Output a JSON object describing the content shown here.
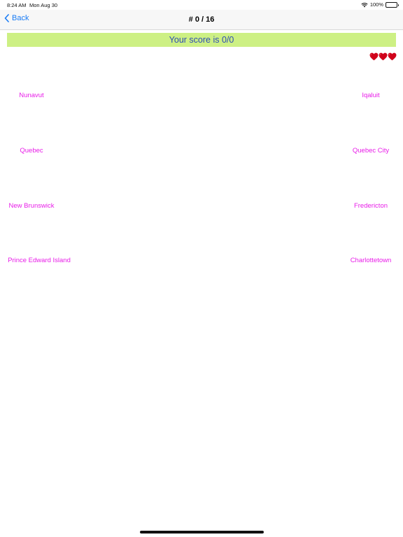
{
  "status_bar": {
    "time": "8:24 AM",
    "date": "Mon Aug 30",
    "battery": "100%"
  },
  "nav": {
    "back_label": "Back",
    "title": "# 0 / 16"
  },
  "score": {
    "text": "Your score is 0/0"
  },
  "lives": {
    "count": 3,
    "icon": "heart-icon",
    "color": "#d0021b"
  },
  "provinces": [
    {
      "label": "Nunavut"
    },
    {
      "label": "Quebec"
    },
    {
      "label": "New Brunswick"
    },
    {
      "label": "Prince Edward Island"
    }
  ],
  "capitals": [
    {
      "label": "Iqaluit"
    },
    {
      "label": "Quebec City"
    },
    {
      "label": "Fredericton"
    },
    {
      "label": "Charlottetown"
    }
  ],
  "colors": {
    "accent": "#1a7cf5",
    "item_text": "#e81ce8",
    "score_bg": "#cdf084",
    "score_text": "#2d4db3"
  }
}
